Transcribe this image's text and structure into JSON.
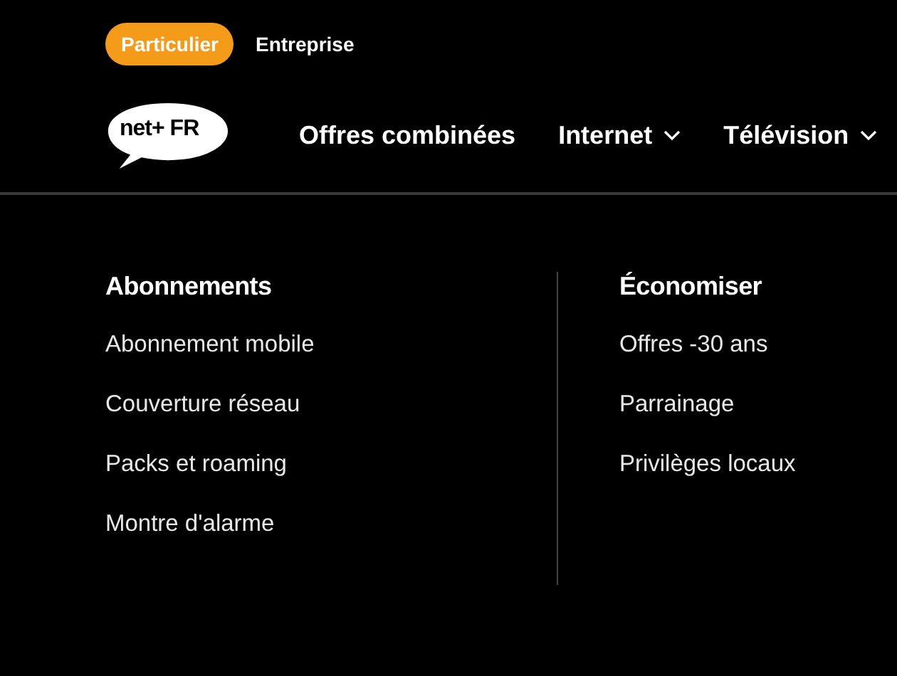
{
  "segments": [
    {
      "label": "Particulier",
      "selected": true
    },
    {
      "label": "Entreprise",
      "selected": false
    }
  ],
  "logo": {
    "text": "net+ FR"
  },
  "nav": [
    {
      "label": "Offres combinées",
      "has_menu": false
    },
    {
      "label": "Internet",
      "has_menu": true
    },
    {
      "label": "Télévision",
      "has_menu": true
    }
  ],
  "menu_columns": [
    {
      "title": "Abonnements",
      "links": [
        "Abonnement mobile",
        "Couverture réseau",
        "Packs et roaming",
        "Montre d'alarme"
      ]
    },
    {
      "title": "Économiser",
      "links": [
        "Offres -30 ans",
        "Parrainage",
        "Privilèges locaux"
      ]
    }
  ]
}
